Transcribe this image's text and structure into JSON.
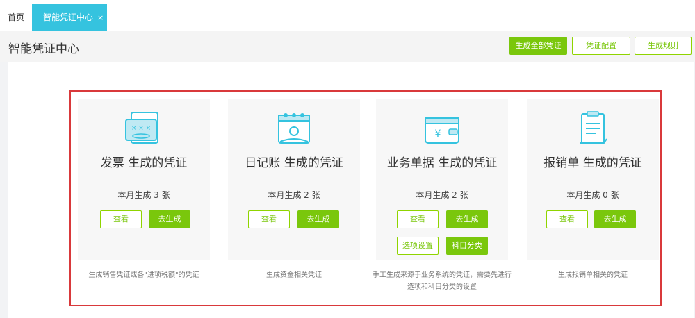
{
  "tabs": {
    "home": "首页",
    "active": "智能凭证中心",
    "close": "×"
  },
  "page": {
    "title": "智能凭证中心",
    "actions": {
      "generate_all": "生成全部凭证",
      "config": "凭证配置",
      "rules": "生成规则"
    }
  },
  "cards": [
    {
      "title": "发票 生成的凭证",
      "count": "本月生成 3 张",
      "view": "查看",
      "generate": "去生成",
      "desc": "生成销售凭证或各\"进项税额\"的凭证",
      "icon": "invoice-icon"
    },
    {
      "title": "日记账 生成的凭证",
      "count": "本月生成 2 张",
      "view": "查看",
      "generate": "去生成",
      "desc": "生成资金相关凭证",
      "icon": "journal-calendar-icon"
    },
    {
      "title": "业务单据 生成的凭证",
      "count": "本月生成 2 张",
      "view": "查看",
      "generate": "去生成",
      "option_settings": "选项设置",
      "subject_category": "科目分类",
      "desc_line1": "手工生成来源于业务系统的凭证，需要先进行",
      "desc_line2": "选项和科目分类的设置",
      "icon": "wallet-icon"
    },
    {
      "title": "报销单 生成的凭证",
      "count": "本月生成 0 张",
      "view": "查看",
      "generate": "去生成",
      "desc": "生成报销单相关的凭证",
      "icon": "expense-report-icon"
    }
  ],
  "colors": {
    "accent_tab": "#35c3df",
    "green": "#7ac70c",
    "frame_red": "#d9393b"
  }
}
